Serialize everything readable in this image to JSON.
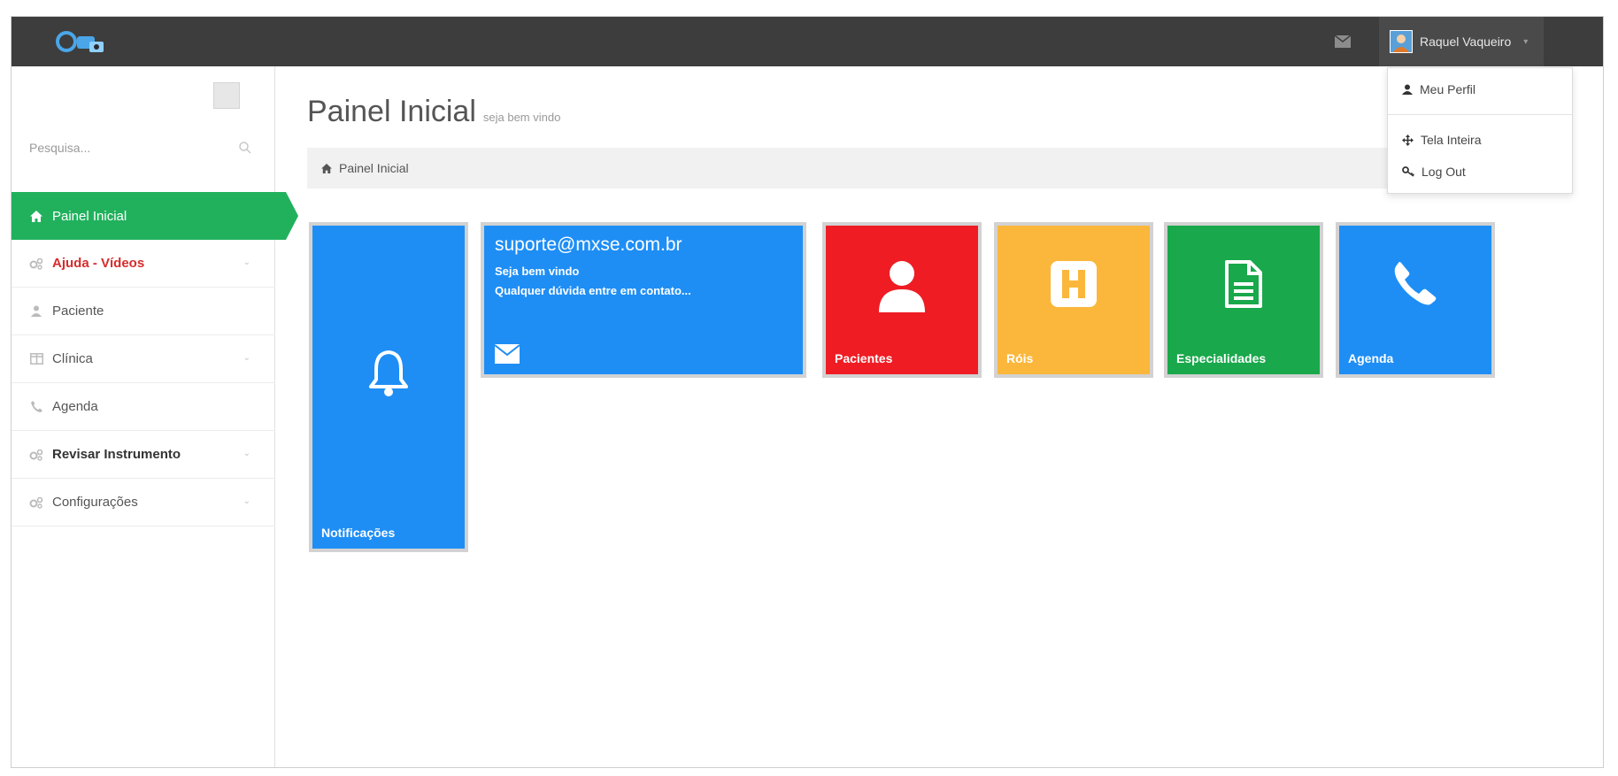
{
  "topbar": {
    "user_name": "Raquel Vaqueiro",
    "colors": {
      "bar": "#3d3d3d"
    }
  },
  "user_menu": {
    "items": [
      {
        "label": "Meu Perfil",
        "icon": "user-icon"
      },
      {
        "label": "Tela Inteira",
        "icon": "move-icon"
      },
      {
        "label": "Log Out",
        "icon": "key-icon"
      }
    ]
  },
  "sidebar": {
    "search_placeholder": "Pesquisa...",
    "items": [
      {
        "label": "Painel Inicial",
        "icon": "home-icon",
        "active": true
      },
      {
        "label": "Ajuda - Vídeos",
        "icon": "gears-icon",
        "has_submenu": true
      },
      {
        "label": "Paciente",
        "icon": "user-icon"
      },
      {
        "label": "Clínica",
        "icon": "columns-icon",
        "has_submenu": true
      },
      {
        "label": "Agenda",
        "icon": "phone-icon"
      },
      {
        "label": "Revisar Instrumento",
        "icon": "gears-icon",
        "has_submenu": true
      },
      {
        "label": "Configurações",
        "icon": "gears-icon",
        "has_submenu": true
      }
    ],
    "colors": {
      "active": "#21b15d",
      "highlight_text": "#d62c2c"
    }
  },
  "main": {
    "title": "Painel Inicial",
    "subtitle": "seja bem vindo",
    "breadcrumb": "Painel Inicial"
  },
  "tiles": {
    "notifications": {
      "label": "Notificações",
      "icon": "bell-icon",
      "color": "#1e8ef5"
    },
    "contact": {
      "email": "suporte@mxse.com.br",
      "line1": "Seja bem vindo",
      "line2": "Qualquer dúvida entre em contato...",
      "icon": "envelope-icon",
      "color": "#1e8ef5"
    },
    "pacientes": {
      "label": "Pacientes",
      "icon": "user-icon",
      "color": "#ef1c24"
    },
    "rol": {
      "label": "Róis",
      "icon": "hospital-icon",
      "color": "#fbb73b"
    },
    "especialidades": {
      "label": "Especialidades",
      "icon": "document-icon",
      "color": "#19a84b"
    },
    "agenda": {
      "label": "Agenda",
      "icon": "phone-icon",
      "color": "#1e8ef5"
    }
  }
}
